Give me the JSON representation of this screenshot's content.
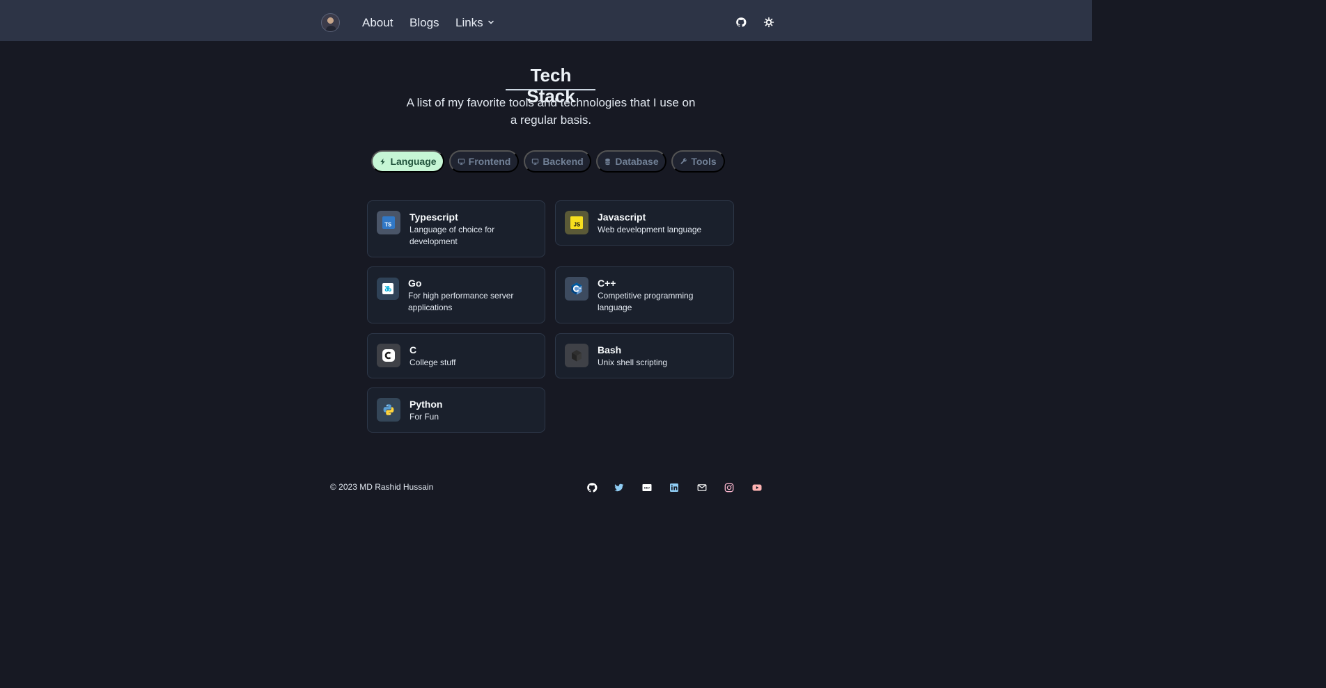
{
  "nav": {
    "links": {
      "about": "About",
      "blogs": "Blogs",
      "links": "Links"
    },
    "icons": [
      "github-icon",
      "theme-toggle-icon"
    ]
  },
  "page": {
    "title": "Tech Stack",
    "subtitle": "A list of my favorite tools and technologies that I use on a regular basis."
  },
  "tabs": [
    {
      "label": "Language",
      "icon": "bolt-icon",
      "active": true
    },
    {
      "label": "Frontend",
      "icon": "monitor-icon",
      "active": false
    },
    {
      "label": "Backend",
      "icon": "monitor-icon",
      "active": false
    },
    {
      "label": "Database",
      "icon": "database-icon",
      "active": false
    },
    {
      "label": "Tools",
      "icon": "wrench-icon",
      "active": false
    }
  ],
  "cards": [
    {
      "title": "Typescript",
      "description": "Language of choice for development",
      "icon": "typescript-icon"
    },
    {
      "title": "Javascript",
      "description": "Web development language",
      "icon": "javascript-icon"
    },
    {
      "title": "Go",
      "description": "For high performance server applications",
      "icon": "go-icon"
    },
    {
      "title": "C++",
      "description": "Competitive programming language",
      "icon": "cpp-icon"
    },
    {
      "title": "C",
      "description": "College stuff",
      "icon": "c-icon"
    },
    {
      "title": "Bash",
      "description": "Unix shell scripting",
      "icon": "bash-icon"
    },
    {
      "title": "Python",
      "description": "For Fun",
      "icon": "python-icon"
    }
  ],
  "footer": {
    "copyright": "© 2023 MD Rashid Hussain",
    "icons": [
      "github-icon",
      "twitter-icon",
      "dev-icon",
      "linkedin-icon",
      "mail-icon",
      "instagram-icon",
      "youtube-icon"
    ]
  },
  "colors": {
    "background": "#171923",
    "navbar": "#2d3446",
    "active_tab": "#c6f6d5",
    "active_tab_text": "#22543d",
    "card_border": "#2d3748"
  }
}
